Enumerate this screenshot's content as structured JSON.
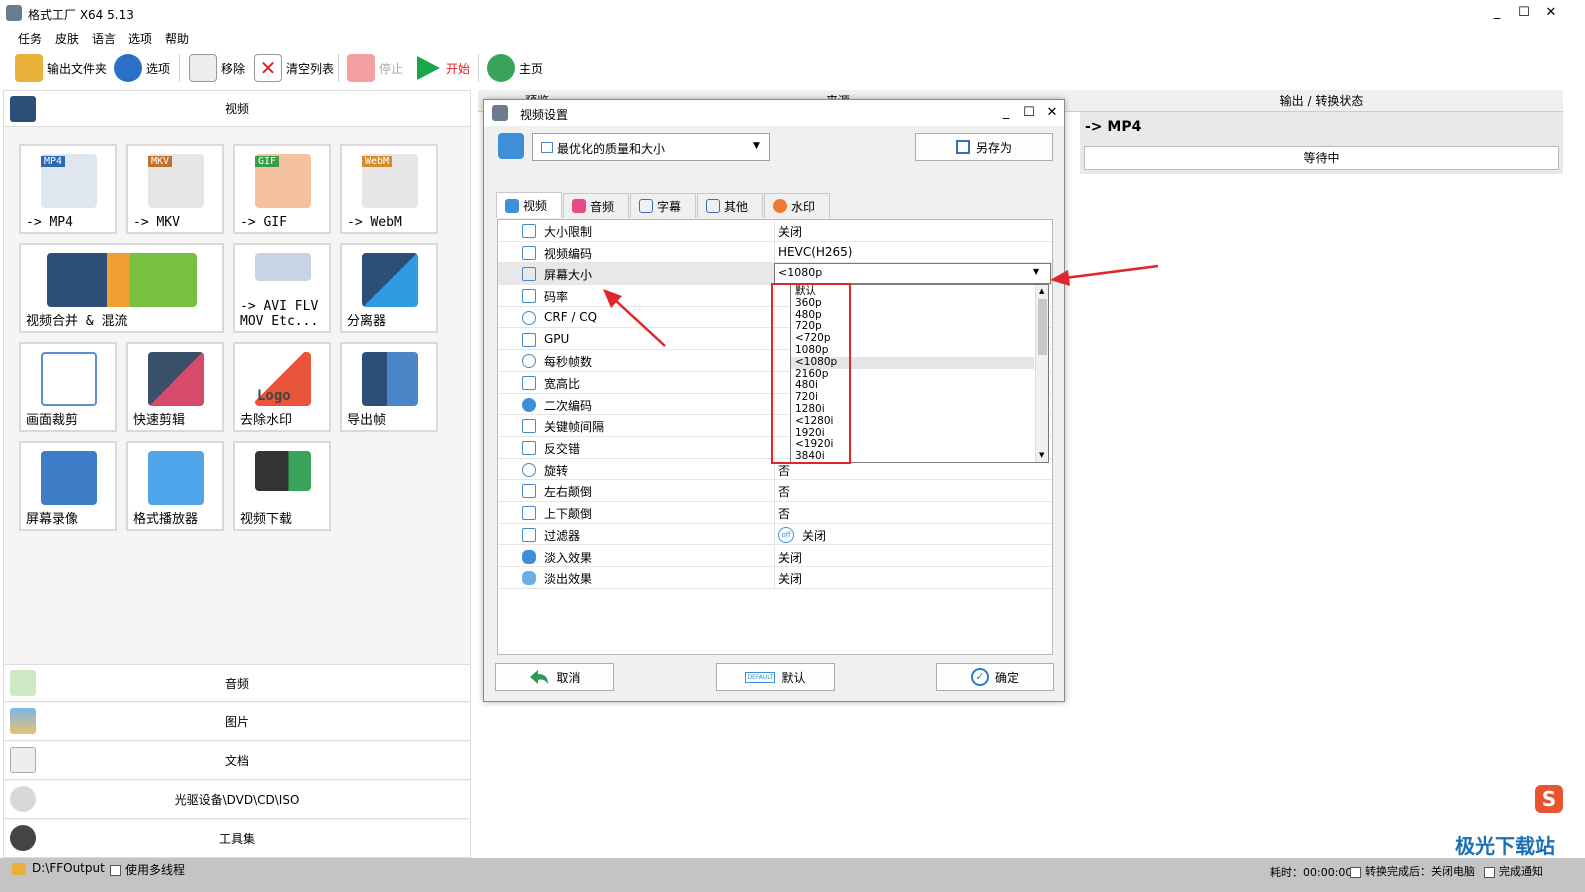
{
  "window": {
    "title": "格式工厂 X64 5.13",
    "minimize": "_",
    "maximize": "☐",
    "close": "✕"
  },
  "menu": [
    "任务",
    "皮肤",
    "语言",
    "选项",
    "帮助"
  ],
  "toolbar": {
    "output_folder": "输出文件夹",
    "options": "选项",
    "remove": "移除",
    "clear_list": "清空列表",
    "stop": "停止",
    "start": "开始",
    "home": "主页"
  },
  "left": {
    "video_header": "视频",
    "tiles": [
      {
        "label": "-> MP4",
        "badge": "MP4"
      },
      {
        "label": "-> MKV",
        "badge": "MKV"
      },
      {
        "label": "-> GIF",
        "badge": "GIF"
      },
      {
        "label": "-> WebM",
        "badge": "WebM"
      },
      {
        "label": "视频合并 & 混流"
      },
      {
        "label": "-> AVI FLV\nMOV Etc..."
      },
      {
        "label": "分离器"
      },
      {
        "label": "画面裁剪"
      },
      {
        "label": "快速剪辑"
      },
      {
        "label": "去除水印",
        "logo_text": "Logo"
      },
      {
        "label": "导出帧"
      },
      {
        "label": "屏幕录像"
      },
      {
        "label": "格式播放器"
      },
      {
        "label": "视频下载"
      }
    ],
    "categories": [
      "音频",
      "图片",
      "文档",
      "光驱设备\\DVD\\CD\\ISO",
      "工具集"
    ]
  },
  "right": {
    "col_preview": "预览",
    "col_source": "来源",
    "col_status": "输出 / 转换状态",
    "target": "-> MP4",
    "state": "等待中"
  },
  "dialog": {
    "title": "视频设置",
    "preset": "最优化的质量和大小",
    "save_as": "另存为",
    "tabs": [
      "视频",
      "音频",
      "字幕",
      "其他",
      "水印"
    ],
    "rows": [
      {
        "k": "大小限制",
        "v": "关闭"
      },
      {
        "k": "视频编码",
        "v": "HEVC(H265)"
      },
      {
        "k": "屏幕大小",
        "v": "<1080p"
      },
      {
        "k": "码率",
        "v": ""
      },
      {
        "k": "CRF / CQ",
        "v": ""
      },
      {
        "k": "GPU",
        "v": ""
      },
      {
        "k": "每秒帧数",
        "v": ""
      },
      {
        "k": "宽高比",
        "v": ""
      },
      {
        "k": "二次编码",
        "v": ""
      },
      {
        "k": "关键帧间隔",
        "v": ""
      },
      {
        "k": "反交错",
        "v": ""
      },
      {
        "k": "旋转",
        "v": "否"
      },
      {
        "k": "左右颠倒",
        "v": "否"
      },
      {
        "k": "上下颠倒",
        "v": "否"
      },
      {
        "k": "过滤器",
        "v": "关闭",
        "off_badge": "off"
      },
      {
        "k": "淡入效果",
        "v": "关闭"
      },
      {
        "k": "淡出效果",
        "v": "关闭"
      }
    ],
    "dropdown_options": [
      "默认",
      "360p",
      "480p",
      "720p",
      "<720p",
      "1080p",
      "<1080p",
      "2160p",
      "480i",
      "720i",
      "1280i",
      "<1280i",
      "1920i",
      "<1920i",
      "3840i"
    ],
    "selected_option": "<1080p",
    "cancel": "取消",
    "default": "默认",
    "ok": "确定",
    "default_badge": "DEFAULT"
  },
  "status": {
    "path": "D:\\FFOutput",
    "multithread": "使用多线程",
    "elapsed": "耗时：00:00:00",
    "after_done": "转换完成后：关闭电脑",
    "notify": "完成通知"
  },
  "watermark": {
    "text": "极光下载站",
    "glyph": "S"
  },
  "colors": {
    "accent": "#1a6fb5",
    "annotation_red": "#e0262a",
    "start_green": "#18a84a"
  }
}
